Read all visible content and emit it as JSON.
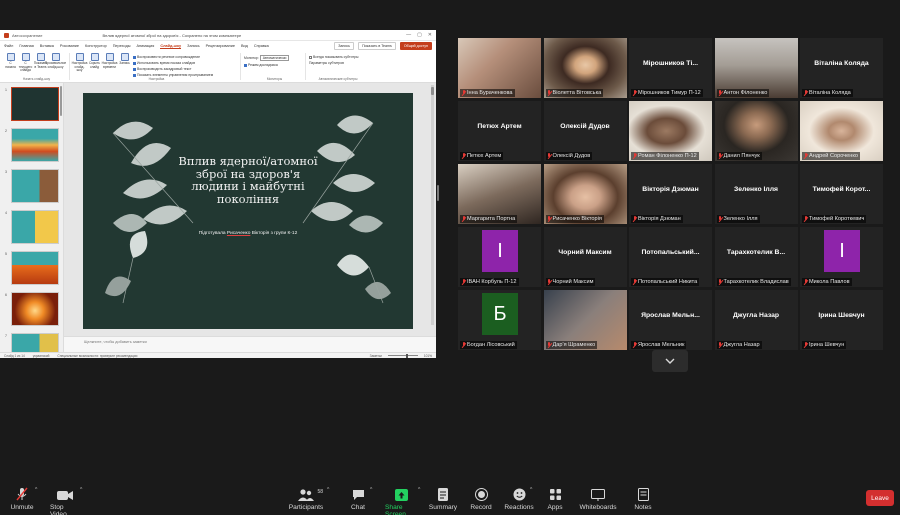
{
  "powerpoint": {
    "title_bar": {
      "left_text": "Автосохранение",
      "document": "Вплив ядерної атомної зброї на здоров'я - Сохранено на этом компьютере",
      "controls": [
        "—",
        "▢",
        "✕"
      ]
    },
    "menu": {
      "items": [
        "Файл",
        "Главная",
        "Вставка",
        "Рисование",
        "Конструктор",
        "Переходы",
        "Анимация",
        "Слайд-шоу",
        "Запись",
        "Рецензирование",
        "Вид",
        "Справка"
      ],
      "active_index": 7,
      "right_buttons": [
        "Запись",
        "Показать в Teams",
        "Общий доступ"
      ]
    },
    "ribbon": {
      "start_buttons": [
        "С начала",
        "С текущего слайда",
        "Показать в Teams",
        "Произвольное слайд-шоу"
      ],
      "start_group_label": "Начать слайд-шоу",
      "setup_buttons": [
        "Настройка слайд-шоу",
        "Скрыть слайд",
        "Настройка времени",
        "Запись"
      ],
      "setup_checks": [
        {
          "label": "Воспроизвести речевое сопровождение",
          "on": true
        },
        {
          "label": "Использовать время показа слайдов",
          "on": true
        },
        {
          "label": "Воспроизводить закадровый текст",
          "on": true
        },
        {
          "label": "Показать элементы управления проигрыванием",
          "on": true
        }
      ],
      "setup_group_label": "Настройка",
      "monitor_label": "Монитор:",
      "monitor_value": "Автоматически",
      "monitor_checks": [
        {
          "label": "Режим докладчика",
          "on": true
        }
      ],
      "monitors_group_label": "Мониторы",
      "captions_checks": [
        {
          "label": "Всегда показывать субтитры",
          "on": false
        }
      ],
      "captions_label": "Параметры субтитров",
      "captions_group_label": "Автоматические субтитры"
    },
    "slides": [
      {
        "n": "1",
        "cls": "t1"
      },
      {
        "n": "2",
        "cls": "t2"
      },
      {
        "n": "3",
        "cls": "t3"
      },
      {
        "n": "4",
        "cls": "t4"
      },
      {
        "n": "5",
        "cls": "t5"
      },
      {
        "n": "6",
        "cls": "t6"
      },
      {
        "n": "7",
        "cls": "t7"
      }
    ],
    "current_slide": {
      "title": "Вплив ядерної/атомної зброї на здоров'я людини і майбутні покоління",
      "subtitle_prefix": "Підготувала ",
      "subtitle_name": "Рисаченко",
      "subtitle_suffix": " Вікторія з групи К-12"
    },
    "notes_placeholder": "Щелкните, чтобы добавить заметки",
    "status": {
      "slide_info": "Слайд 1 из 14",
      "language": "украинский",
      "accessibility": "Специальные возможности: проверьте рекомендации",
      "notes_btn": "Заметки",
      "zoom": "101%"
    }
  },
  "gallery": {
    "tiles": [
      {
        "name": "",
        "label": "Інна Бураченкова",
        "video": "c1",
        "avatar": "",
        "avatar_color": ""
      },
      {
        "name": "",
        "label": "Віолетта Вітовська",
        "video": "c2",
        "avatar": "",
        "avatar_color": ""
      },
      {
        "name": "Мірошников Ті...",
        "label": "Мірошников Тимур П-12",
        "video": "",
        "avatar": "",
        "avatar_color": ""
      },
      {
        "name": "",
        "label": "Антон Філоненко",
        "video": "c3",
        "avatar": "",
        "avatar_color": ""
      },
      {
        "name": "Віталіна Коляда",
        "label": "Віталіна Коляда",
        "video": "",
        "avatar": "",
        "avatar_color": ""
      },
      {
        "name": "Петюх Артем",
        "label": "Петюх Артем",
        "video": "",
        "avatar": "",
        "avatar_color": ""
      },
      {
        "name": "Олексій Дудов",
        "label": "Олексій Дудов",
        "video": "",
        "avatar": "",
        "avatar_color": ""
      },
      {
        "name": "",
        "label": "Роман Філоненко П-12",
        "video": "c4",
        "avatar": "",
        "avatar_color": ""
      },
      {
        "name": "",
        "label": "Данил Пянчук",
        "video": "c5",
        "avatar": "",
        "avatar_color": ""
      },
      {
        "name": "",
        "label": "Андрей Сороченко",
        "video": "c6",
        "avatar": "",
        "avatar_color": ""
      },
      {
        "name": "",
        "label": "Маргарита Портна",
        "video": "c7",
        "avatar": "",
        "avatar_color": ""
      },
      {
        "name": "",
        "label": "Рисаченко Вікторія",
        "video": "c8",
        "avatar": "",
        "avatar_color": "",
        "active": true
      },
      {
        "name": "Вікторія Дзюман",
        "label": "Вікторія Дзюман",
        "video": "",
        "avatar": "",
        "avatar_color": ""
      },
      {
        "name": "Зеленко Ілля",
        "label": "Зеленко Ілля",
        "video": "",
        "avatar": "",
        "avatar_color": ""
      },
      {
        "name": "Тимофей Корот...",
        "label": "Тимофей Короткевич",
        "video": "",
        "avatar": "",
        "avatar_color": ""
      },
      {
        "name": "",
        "label": "ІВАН Корбуль П-12",
        "video": "",
        "avatar": "І",
        "avatar_color": "#8e24aa"
      },
      {
        "name": "Чорний Максим",
        "label": "Чорний Максим",
        "video": "",
        "avatar": "",
        "avatar_color": ""
      },
      {
        "name": "Потопальський...",
        "label": "Потопальський Никита",
        "video": "",
        "avatar": "",
        "avatar_color": ""
      },
      {
        "name": "Тарахкотелик В...",
        "label": "Тарахкотелик Владислав",
        "video": "",
        "avatar": "",
        "avatar_color": ""
      },
      {
        "name": "",
        "label": "Микола Павлов",
        "video": "",
        "avatar": "І",
        "avatar_color": "#8e24aa"
      },
      {
        "name": "",
        "label": "Богдан Лісовський",
        "video": "",
        "avatar": "Б",
        "avatar_color": "#1b5e20"
      },
      {
        "name": "",
        "label": "Дар'я Шраменко",
        "video": "c9",
        "avatar": "",
        "avatar_color": ""
      },
      {
        "name": "Ярослав Мельн...",
        "label": "Ярослав Мельник",
        "video": "",
        "avatar": "",
        "avatar_color": ""
      },
      {
        "name": "Джугла Назар",
        "label": "Джугла Назар",
        "video": "",
        "avatar": "",
        "avatar_color": ""
      },
      {
        "name": "Ірина Шевчун",
        "label": "Ірина Шевчун",
        "video": "",
        "avatar": "",
        "avatar_color": ""
      }
    ]
  },
  "toolbar": {
    "unmute": "Unmute",
    "stop_video": "Stop Video",
    "participants": "Participants",
    "participants_count": "58",
    "chat": "Chat",
    "share_screen": "Share Screen",
    "summary": "Summary",
    "record": "Record",
    "reactions": "Reactions",
    "apps": "Apps",
    "whiteboards": "Whiteboards",
    "notes": "Notes",
    "leave": "Leave"
  },
  "colors": {
    "background": "#1a1a1a",
    "tile": "#232323",
    "active_speaker": "#e3e321",
    "share_green": "#23d160",
    "leave_red": "#d32f2f",
    "pp_accent": "#c43e1c",
    "slide_bg": "#223832"
  }
}
